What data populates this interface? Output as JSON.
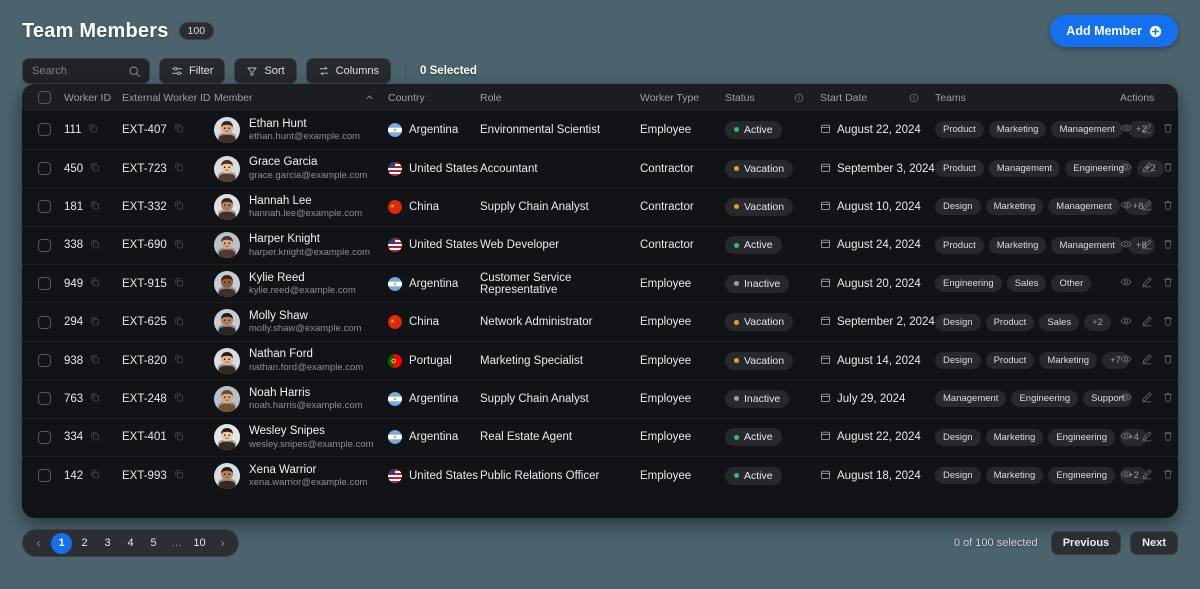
{
  "header": {
    "title": "Team Members",
    "count_badge": "100",
    "add_button": "Add Member",
    "add_icon": "plus-circle-icon"
  },
  "toolbar": {
    "search_placeholder": "Search",
    "search_value": "",
    "search_icon": "search-icon",
    "filter_label": "Filter",
    "filter_icon": "sliders-icon",
    "sort_label": "Sort",
    "sort_icon": "funnel-icon",
    "columns_label": "Columns",
    "columns_icon": "columns-swap-icon",
    "selected_label": "0 Selected"
  },
  "table": {
    "columns": [
      {
        "key": "checkbox",
        "label": ""
      },
      {
        "key": "worker_id",
        "label": "Worker ID"
      },
      {
        "key": "external_worker_id",
        "label": "External Worker ID"
      },
      {
        "key": "member",
        "label": "Member",
        "sort": "asc",
        "sort_icon": "chevron-up-icon"
      },
      {
        "key": "country",
        "label": "Country"
      },
      {
        "key": "role",
        "label": "Role"
      },
      {
        "key": "worker_type",
        "label": "Worker Type"
      },
      {
        "key": "status",
        "label": "Status",
        "info_icon": "info-icon"
      },
      {
        "key": "start_date",
        "label": "Start Date",
        "info_icon": "info-icon"
      },
      {
        "key": "teams",
        "label": "Teams"
      },
      {
        "key": "actions",
        "label": "Actions"
      }
    ],
    "status_colors": {
      "Active": "#2fbf5c",
      "Vacation": "#e89e22",
      "Inactive": "#9aa0a7"
    },
    "row_action_icons": [
      "eye-icon",
      "pencil-icon",
      "trash-icon"
    ],
    "rows": [
      {
        "worker_id": "111",
        "external_worker_id": "EXT-407",
        "name": "Ethan Hunt",
        "email": "ethan.hunt@example.com",
        "country": "Argentina",
        "flag": "ar",
        "role": "Environmental Scientist",
        "worker_type": "Employee",
        "status": "Active",
        "start_date": "August 22, 2024",
        "teams": [
          "Product",
          "Marketing",
          "Management"
        ],
        "teams_more": "+2"
      },
      {
        "worker_id": "450",
        "external_worker_id": "EXT-723",
        "name": "Grace Garcia",
        "email": "grace.garcia@example.com",
        "country": "United States",
        "flag": "us",
        "role": "Accountant",
        "worker_type": "Contractor",
        "status": "Vacation",
        "start_date": "September 3, 2024",
        "teams": [
          "Product",
          "Management",
          "Engineering"
        ],
        "teams_more": "+2"
      },
      {
        "worker_id": "181",
        "external_worker_id": "EXT-332",
        "name": "Hannah Lee",
        "email": "hannah.lee@example.com",
        "country": "China",
        "flag": "cn",
        "role": "Supply Chain Analyst",
        "worker_type": "Contractor",
        "status": "Vacation",
        "start_date": "August 10, 2024",
        "teams": [
          "Design",
          "Marketing",
          "Management"
        ],
        "teams_more": "+8"
      },
      {
        "worker_id": "338",
        "external_worker_id": "EXT-690",
        "name": "Harper Knight",
        "email": "harper.knight@example.com",
        "country": "United States",
        "flag": "us",
        "role": "Web Developer",
        "worker_type": "Contractor",
        "status": "Active",
        "start_date": "August 24, 2024",
        "teams": [
          "Product",
          "Marketing",
          "Management"
        ],
        "teams_more": "+8"
      },
      {
        "worker_id": "949",
        "external_worker_id": "EXT-915",
        "name": "Kylie Reed",
        "email": "kylie.reed@example.com",
        "country": "Argentina",
        "flag": "ar",
        "role": "Customer Service Representative",
        "worker_type": "Employee",
        "status": "Inactive",
        "start_date": "August 20, 2024",
        "teams": [
          "Engineering",
          "Sales",
          "Other"
        ],
        "teams_more": ""
      },
      {
        "worker_id": "294",
        "external_worker_id": "EXT-625",
        "name": "Molly Shaw",
        "email": "molly.shaw@example.com",
        "country": "China",
        "flag": "cn",
        "role": "Network Administrator",
        "worker_type": "Employee",
        "status": "Vacation",
        "start_date": "September 2, 2024",
        "teams": [
          "Design",
          "Product",
          "Sales"
        ],
        "teams_more": "+2"
      },
      {
        "worker_id": "938",
        "external_worker_id": "EXT-820",
        "name": "Nathan Ford",
        "email": "nathan.ford@example.com",
        "country": "Portugal",
        "flag": "pt",
        "role": "Marketing Specialist",
        "worker_type": "Employee",
        "status": "Vacation",
        "start_date": "August 14, 2024",
        "teams": [
          "Design",
          "Product",
          "Marketing"
        ],
        "teams_more": "+7"
      },
      {
        "worker_id": "763",
        "external_worker_id": "EXT-248",
        "name": "Noah Harris",
        "email": "noah.harris@example.com",
        "country": "Argentina",
        "flag": "ar",
        "role": "Supply Chain Analyst",
        "worker_type": "Employee",
        "status": "Inactive",
        "start_date": "July 29, 2024",
        "teams": [
          "Management",
          "Engineering",
          "Support"
        ],
        "teams_more": ""
      },
      {
        "worker_id": "334",
        "external_worker_id": "EXT-401",
        "name": "Wesley Snipes",
        "email": "wesley.snipes@example.com",
        "country": "Argentina",
        "flag": "ar",
        "role": "Real Estate Agent",
        "worker_type": "Employee",
        "status": "Active",
        "start_date": "August 22, 2024",
        "teams": [
          "Design",
          "Marketing",
          "Engineering"
        ],
        "teams_more": "+4"
      },
      {
        "worker_id": "142",
        "external_worker_id": "EXT-993",
        "name": "Xena Warrior",
        "email": "xena.warrior@example.com",
        "country": "United States",
        "flag": "us",
        "role": "Public Relations Officer",
        "worker_type": "Employee",
        "status": "Active",
        "start_date": "August 18, 2024",
        "teams": [
          "Design",
          "Marketing",
          "Engineering"
        ],
        "teams_more": "+2"
      }
    ]
  },
  "footer": {
    "pages": [
      "1",
      "2",
      "3",
      "4",
      "5",
      "…",
      "10"
    ],
    "active_page": "1",
    "prev_arrow": "‹",
    "next_arrow": "›",
    "selected_summary": "0 of 100 selected",
    "previous_label": "Previous",
    "next_label": "Next"
  },
  "colors": {
    "accent": "#1470ef",
    "page_bg": "#4a636d",
    "card_bg": "#121316"
  }
}
